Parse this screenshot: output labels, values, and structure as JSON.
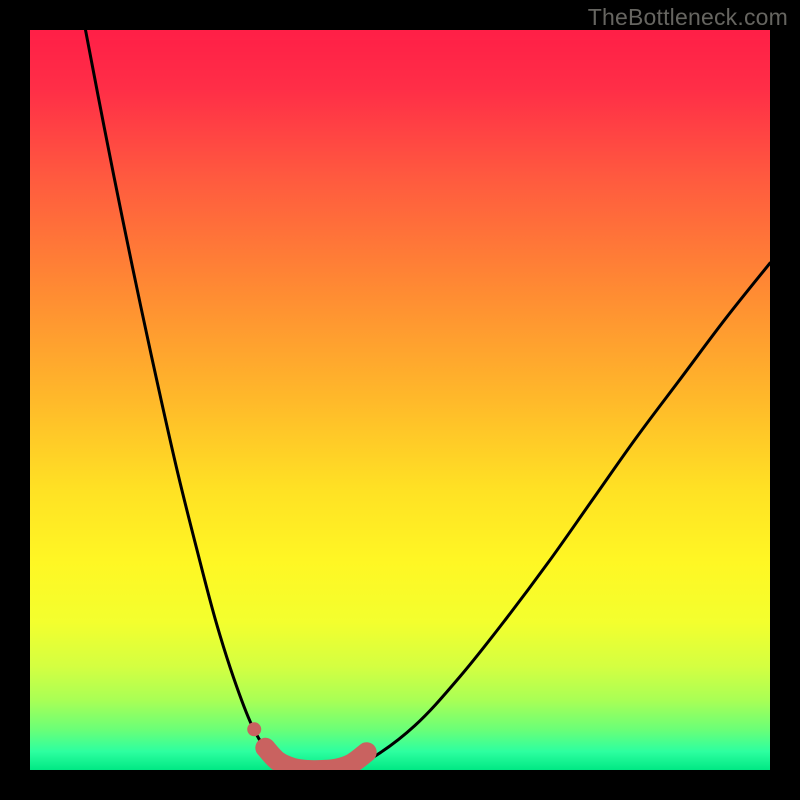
{
  "watermark": "TheBottleneck.com",
  "chart_data": {
    "type": "line",
    "title": "",
    "xlabel": "",
    "ylabel": "",
    "xlim": [
      0,
      1
    ],
    "ylim": [
      0,
      1
    ],
    "series": [
      {
        "name": "curve",
        "x": [
          0.075,
          0.1,
          0.125,
          0.15,
          0.175,
          0.2,
          0.225,
          0.25,
          0.275,
          0.3,
          0.325,
          0.35,
          0.38,
          0.42,
          0.46,
          0.52,
          0.58,
          0.64,
          0.7,
          0.76,
          0.82,
          0.88,
          0.94,
          1.0
        ],
        "y": [
          1.0,
          0.87,
          0.745,
          0.625,
          0.51,
          0.4,
          0.3,
          0.205,
          0.125,
          0.06,
          0.02,
          0.004,
          0.0,
          0.0,
          0.015,
          0.06,
          0.125,
          0.2,
          0.28,
          0.365,
          0.45,
          0.53,
          0.61,
          0.685
        ]
      },
      {
        "name": "highlight",
        "x": [
          0.318,
          0.335,
          0.355,
          0.375,
          0.395,
          0.415,
          0.435,
          0.455
        ],
        "y": [
          0.03,
          0.012,
          0.003,
          0.0,
          0.0,
          0.002,
          0.009,
          0.024
        ]
      },
      {
        "name": "highlight-dot",
        "x": [
          0.303
        ],
        "y": [
          0.055
        ]
      }
    ],
    "gradient_stops": [
      {
        "offset": 0.0,
        "color": "#ff1f47"
      },
      {
        "offset": 0.08,
        "color": "#ff2e47"
      },
      {
        "offset": 0.2,
        "color": "#ff5a3f"
      },
      {
        "offset": 0.35,
        "color": "#ff8a33"
      },
      {
        "offset": 0.5,
        "color": "#ffb92a"
      },
      {
        "offset": 0.62,
        "color": "#ffe124"
      },
      {
        "offset": 0.72,
        "color": "#fff724"
      },
      {
        "offset": 0.8,
        "color": "#f3ff2e"
      },
      {
        "offset": 0.86,
        "color": "#d4ff41"
      },
      {
        "offset": 0.905,
        "color": "#aaff55"
      },
      {
        "offset": 0.945,
        "color": "#6bff77"
      },
      {
        "offset": 0.975,
        "color": "#2dffa0"
      },
      {
        "offset": 1.0,
        "color": "#00e884"
      }
    ],
    "colors": {
      "curve": "#000000",
      "highlight": "#c96260"
    }
  }
}
